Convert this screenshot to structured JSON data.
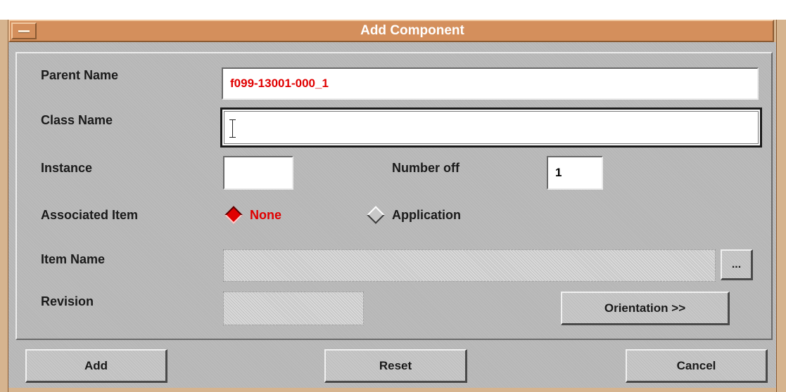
{
  "window": {
    "title": "Add Component"
  },
  "form": {
    "parent_name": {
      "label": "Parent Name",
      "value": "f099-13001-000_1"
    },
    "class_name": {
      "label": "Class Name",
      "value": ""
    },
    "instance": {
      "label": "Instance",
      "value": ""
    },
    "number_off": {
      "label": "Number off",
      "value": "1"
    },
    "associated_item": {
      "label": "Associated Item",
      "options": [
        {
          "label": "None",
          "selected": true
        },
        {
          "label": "Application",
          "selected": false
        }
      ]
    },
    "item_name": {
      "label": "Item Name",
      "value": "",
      "browse_label": "..."
    },
    "revision": {
      "label": "Revision",
      "value": ""
    },
    "orientation_label": "Orientation >>"
  },
  "footer": {
    "add_label": "Add",
    "reset_label": "Reset",
    "cancel_label": "Cancel"
  },
  "colors": {
    "title_bar": "#d48f5c",
    "dialog_bg": "#b6b6b6",
    "accent_red": "#e00000"
  },
  "icons": {
    "window_menu": "window-menu-icon",
    "radio_selected": "radio-diamond-selected-icon",
    "radio_unselected": "radio-diamond-unselected-icon",
    "text_cursor": "text-cursor-icon"
  }
}
